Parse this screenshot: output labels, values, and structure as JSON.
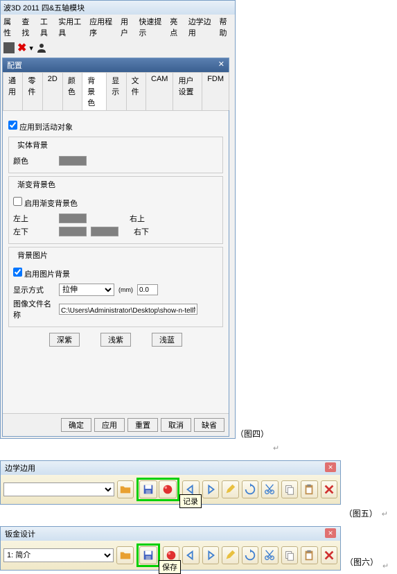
{
  "main_window": {
    "title": "波3D 2011 四&五轴模块",
    "menu": [
      "属性",
      "查找",
      "工具",
      "实用工具",
      "应用程序",
      "用户",
      "快速提示",
      "亮点",
      "边学边用",
      "帮助"
    ]
  },
  "dialog": {
    "title": "配置",
    "tabs": [
      "通用",
      "零件",
      "2D",
      "颜色",
      "背景色",
      "显示",
      "文件",
      "CAM",
      "用户设置",
      "FDM"
    ],
    "active_tab": "背景色",
    "apply_to_active": "应用到活动对象",
    "solid_bg": {
      "title": "实体背景",
      "color_label": "颜色"
    },
    "grad_bg": {
      "title": "渐变背景色",
      "enable": "启用渐变背景色",
      "top_left": "左上",
      "top_right": "右上",
      "bottom_left": "左下",
      "bottom_right": "右下"
    },
    "image_bg": {
      "title": "背景图片",
      "enable": "启用图片背景",
      "display_mode": "显示方式",
      "display_value": "拉伸",
      "unit": "(mm)",
      "unit_val": "0.0",
      "filename_label": "图像文件名称",
      "filename": "C:\\Users\\Administrator\\Desktop\\show-n-tell制作\\扳金"
    },
    "presets": [
      "深紫",
      "浅紫",
      "浅蓝"
    ],
    "buttons": [
      "确定",
      "应用",
      "重置",
      "取消",
      "缺省"
    ]
  },
  "captions": {
    "fig4": "（图四）",
    "fig5": "（图五）",
    "fig6": "（图六）"
  },
  "toolbar1": {
    "title": "边学边用",
    "select": "",
    "icons": [
      "folder",
      "save",
      "record",
      "prev",
      "next",
      "pencil",
      "rotate",
      "cut",
      "copy",
      "paste",
      "delete"
    ],
    "tooltip": "记录"
  },
  "toolbar2": {
    "title": "钣金设计",
    "select": "1: 简介",
    "tooltip": "保存",
    "icons": [
      "folder",
      "save",
      "record",
      "prev",
      "next",
      "pencil",
      "rotate",
      "cut",
      "copy",
      "paste",
      "delete"
    ]
  }
}
